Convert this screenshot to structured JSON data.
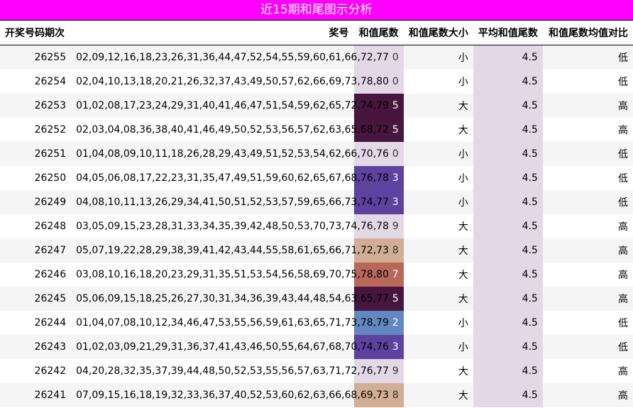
{
  "title": "近15期和尾图示分析",
  "headers": [
    "开奖号码期次",
    "奖号",
    "和值尾数",
    "和值尾数大小",
    "平均和值尾数",
    "和值尾数均值对比"
  ],
  "rows": [
    {
      "period": "26255",
      "numbers": "02,09,12,16,18,23,26,31,36,44,47,52,54,55,59,60,61,66,72,77",
      "tail": "0",
      "size": "小",
      "avg": "4.5",
      "compare": "低",
      "bg": "#e3d9e6",
      "fg": "#333333"
    },
    {
      "period": "26254",
      "numbers": "02,04,10,13,18,20,21,26,32,37,43,49,50,57,62,66,69,73,78,80",
      "tail": "0",
      "size": "小",
      "avg": "4.5",
      "compare": "低",
      "bg": "#e3d9e6",
      "fg": "#333333"
    },
    {
      "period": "26253",
      "numbers": "01,02,08,17,23,24,29,31,40,41,46,47,51,54,59,62,65,72,74,79",
      "tail": "5",
      "size": "大",
      "avg": "4.5",
      "compare": "高",
      "bg": "#46163f",
      "fg": "#ffffff"
    },
    {
      "period": "26252",
      "numbers": "02,03,04,08,36,38,40,41,46,49,50,52,53,56,57,62,63,65,68,72",
      "tail": "5",
      "size": "大",
      "avg": "4.5",
      "compare": "高",
      "bg": "#46163f",
      "fg": "#ffffff"
    },
    {
      "period": "26251",
      "numbers": "01,04,08,09,10,11,18,26,28,29,43,49,51,52,53,54,62,66,70,76",
      "tail": "0",
      "size": "小",
      "avg": "4.5",
      "compare": "低",
      "bg": "#e3d9e6",
      "fg": "#333333"
    },
    {
      "period": "26250",
      "numbers": "04,05,06,08,17,22,23,31,35,47,49,51,59,60,62,65,67,68,76,78",
      "tail": "3",
      "size": "小",
      "avg": "4.5",
      "compare": "低",
      "bg": "#5e42a0",
      "fg": "#ffffff"
    },
    {
      "period": "26249",
      "numbers": "04,08,10,11,13,26,29,34,41,50,51,52,53,57,59,65,66,73,74,77",
      "tail": "3",
      "size": "小",
      "avg": "4.5",
      "compare": "低",
      "bg": "#5e42a0",
      "fg": "#ffffff"
    },
    {
      "period": "26248",
      "numbers": "03,05,09,15,23,28,31,33,34,35,39,42,48,50,53,70,73,74,76,78",
      "tail": "9",
      "size": "大",
      "avg": "4.5",
      "compare": "高",
      "bg": "#e3d9e6",
      "fg": "#333333"
    },
    {
      "period": "26247",
      "numbers": "05,07,19,22,28,29,38,39,41,42,43,44,55,58,61,65,66,71,72,73",
      "tail": "8",
      "size": "大",
      "avg": "4.5",
      "compare": "高",
      "bg": "#d2ae95",
      "fg": "#333333"
    },
    {
      "period": "26246",
      "numbers": "03,08,10,16,18,20,23,29,31,35,51,53,54,56,58,69,70,75,78,80",
      "tail": "7",
      "size": "大",
      "avg": "4.5",
      "compare": "高",
      "bg": "#b8685a",
      "fg": "#ffffff"
    },
    {
      "period": "26245",
      "numbers": "05,06,09,15,18,25,26,27,30,31,34,36,39,43,44,48,54,63,65,77",
      "tail": "5",
      "size": "大",
      "avg": "4.5",
      "compare": "高",
      "bg": "#46163f",
      "fg": "#ffffff"
    },
    {
      "period": "26244",
      "numbers": "01,04,07,08,10,12,34,46,47,53,55,56,59,61,63,65,71,73,78,79",
      "tail": "2",
      "size": "小",
      "avg": "4.5",
      "compare": "低",
      "bg": "#6387c0",
      "fg": "#ffffff"
    },
    {
      "period": "26243",
      "numbers": "01,02,03,09,21,29,31,36,37,41,43,46,50,55,64,67,68,70,74,76",
      "tail": "3",
      "size": "小",
      "avg": "4.5",
      "compare": "低",
      "bg": "#5e42a0",
      "fg": "#ffffff"
    },
    {
      "period": "26242",
      "numbers": "04,20,28,32,35,37,39,44,48,50,52,53,55,56,57,63,71,72,76,77",
      "tail": "9",
      "size": "大",
      "avg": "4.5",
      "compare": "高",
      "bg": "#e3d9e6",
      "fg": "#333333"
    },
    {
      "period": "26241",
      "numbers": "07,09,15,16,18,19,32,33,36,37,40,52,53,60,62,63,66,68,69,73",
      "tail": "8",
      "size": "大",
      "avg": "4.5",
      "compare": "高",
      "bg": "#d2ae95",
      "fg": "#333333"
    }
  ]
}
